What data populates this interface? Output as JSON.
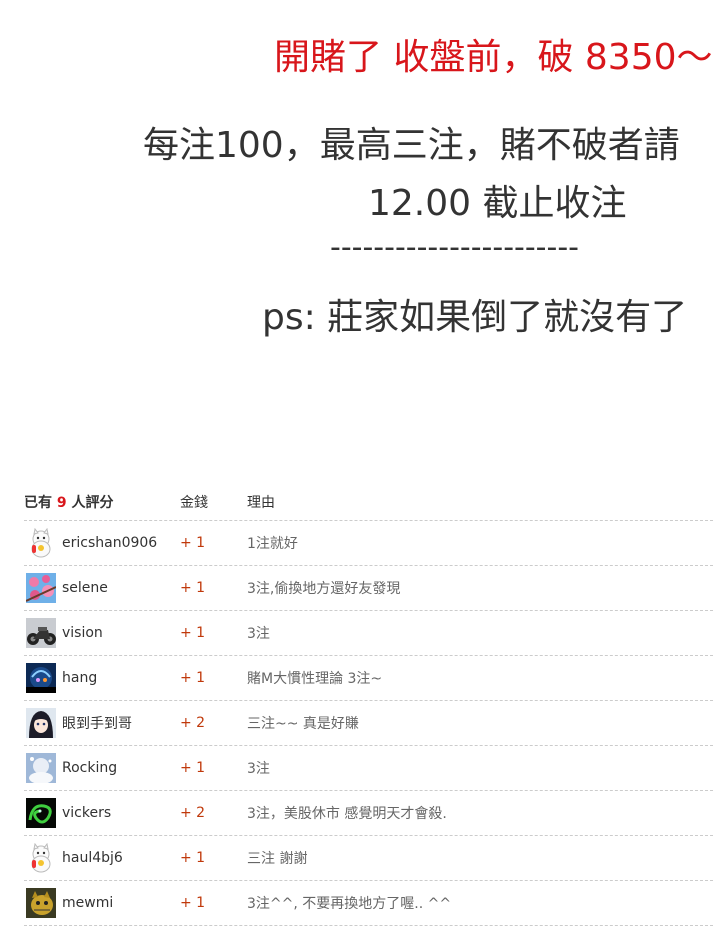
{
  "post": {
    "line1": "開賭了 收盤前，破 8350～",
    "line2": "每注100，最高三注，賭不破者請",
    "line3": "12.00 截止收注",
    "line4": "-----------------------",
    "line5": "ps: 莊家如果倒了就沒有了"
  },
  "rating": {
    "header_prefix": "已有",
    "count": "9",
    "header_suffix": "人評分",
    "col_money": "金錢",
    "col_reason": "理由",
    "rows": [
      {
        "user": "ericshan0906",
        "amount": "+ 1",
        "reason": "1注就好",
        "avatar": "lucky-cat-icon"
      },
      {
        "user": "selene",
        "amount": "+ 1",
        "reason": "3注,偷換地方還好友發現",
        "avatar": "blossom-avatar"
      },
      {
        "user": "vision",
        "amount": "+ 1",
        "reason": "3注",
        "avatar": "motorcycle-avatar"
      },
      {
        "user": "hang",
        "amount": "+ 1",
        "reason": "賭M大慣性理論 3注~",
        "avatar": "dark-character-avatar"
      },
      {
        "user": "眼到手到哥",
        "amount": "+ 2",
        "reason": "三注~~ 真是好賺",
        "avatar": "anime-girl-avatar"
      },
      {
        "user": "Rocking",
        "amount": "+ 1",
        "reason": "3注",
        "avatar": "snowy-avatar"
      },
      {
        "user": "vickers",
        "amount": "+ 2",
        "reason": "3注，美股休市 感覺明天才會殺.",
        "avatar": "green-dragon-avatar"
      },
      {
        "user": "haul4bj6",
        "amount": "+ 1",
        "reason": "三注 謝謝",
        "avatar": "lucky-cat-icon"
      },
      {
        "user": "mewmi",
        "amount": "+ 1",
        "reason": "3注^^, 不要再換地方了喔.. ^^",
        "avatar": "cat-photo-avatar"
      }
    ]
  },
  "colors": {
    "accent_red": "#d8161b",
    "amount_color": "#c0390b"
  }
}
